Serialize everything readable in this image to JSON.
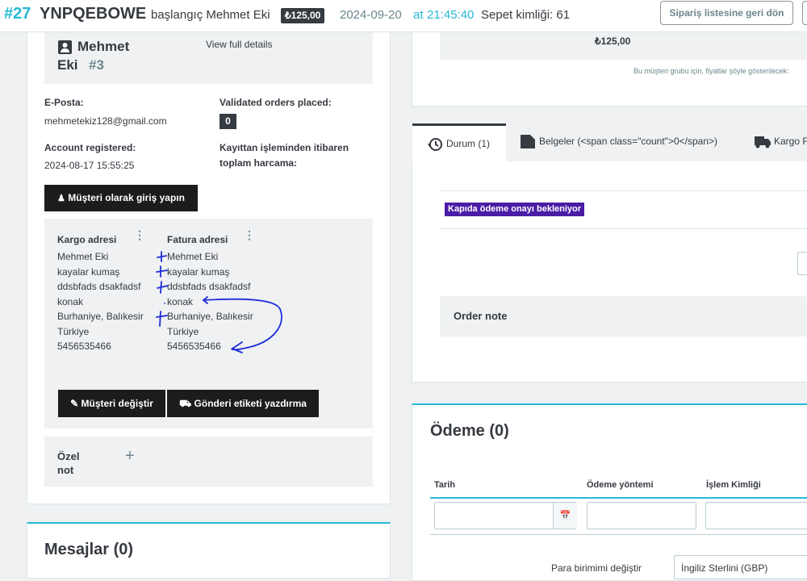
{
  "header": {
    "order_id": "#27",
    "reference": "YNPQEBOWE",
    "placed_by": "başlangıç Mehmet Eki",
    "total": "₺125,00",
    "date": "2024-09-20",
    "at": "at",
    "time": "21:45:40",
    "cart": "Sepet kimliği: 61",
    "back_button": "Sipariş listesine geri dön"
  },
  "customer": {
    "first_name": "Mehmet",
    "last_name": "Eki",
    "id": "#3",
    "view_details": "View full details",
    "email_label": "E-Posta:",
    "email": "mehmetekiz128@gmail.com",
    "validated_label": "Validated orders placed:",
    "validated_count": "0",
    "registered_label": "Account registered:",
    "registered_date": "2024-08-17 15:55:25",
    "spent_label_1": "Kayıttan işleminden itibaren",
    "spent_label_2": "toplam harcama:",
    "login_button": "Müşteri olarak giriş yapın"
  },
  "addresses": {
    "shipping_title": "Kargo adresi",
    "billing_title": "Fatura adresi",
    "shipping": [
      "Mehmet Eki",
      "kayalar kumaş",
      "ddsbfads dsakfadsf",
      "konak",
      "Burhaniye, Balıkesir",
      "Türkiye",
      "5456535466"
    ],
    "billing": [
      "Mehmet Eki",
      "kayalar kumaş",
      "ddsbfads dsakfadsf",
      "konak",
      "Burhaniye, Balıkesir",
      "Türkiye",
      "5456535466"
    ],
    "change_customer": "Müşteri değiştir",
    "print_label": "Gönderi etiketi yazdırma"
  },
  "private_note": {
    "line1": "Özel",
    "line2": "not",
    "plus": "+"
  },
  "messages": {
    "title": "Mesajlar (0)"
  },
  "right_top": {
    "price": "₺125,00",
    "group_note": "Bu müşteri grubu için, fiyatlar şöyle gösterilecek:"
  },
  "tabs": [
    {
      "label": "Durum (1)",
      "icon": "history-icon"
    },
    {
      "label": "Belgeler (<span class=\"count\">0</span>)",
      "icon": "document-icon"
    },
    {
      "label": "Kargo F",
      "icon": "truck-icon"
    }
  ],
  "status": {
    "badge": "Kapıda ödeme onayı bekleniyor",
    "badge_color": "#4b1ca6"
  },
  "order_note": {
    "title": "Order note"
  },
  "payment": {
    "title": "Ödeme (0)",
    "columns": [
      "Tarih",
      "Ödeme yöntemi",
      "İşlem Kimliği"
    ],
    "currency_label": "Para birimimi değiştir",
    "currency_value": "İngiliz Sterlini (GBP)"
  },
  "colors": {
    "accent": "#25b9d7",
    "dark": "#363a41",
    "annotation": "#1d2bd9"
  }
}
